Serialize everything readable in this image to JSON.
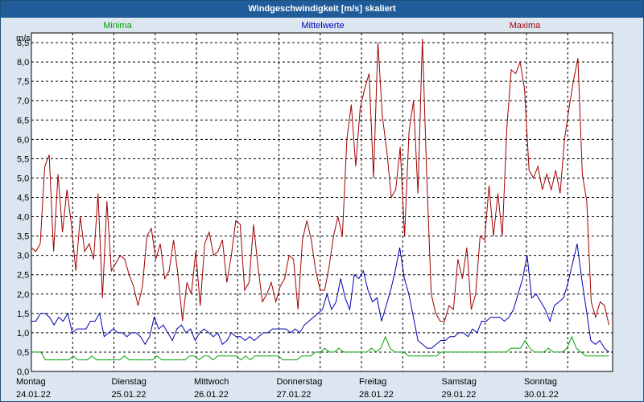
{
  "window": {
    "title": "Windgeschwindigkeit [m/s] skaliert"
  },
  "colors": {
    "background": "#dce6f1",
    "titlebar": "#1f5c99",
    "minima": "#00a000",
    "mittelwerte": "#0000b0",
    "maxima": "#a00000"
  },
  "chart_data": {
    "type": "line",
    "title": "Windgeschwindigkeit [m/s] skaliert",
    "ylabel": "m/s",
    "ylim": [
      0,
      8.75
    ],
    "yticks": [
      "0,0",
      "0,5",
      "1,0",
      "1,5",
      "2,0",
      "2,5",
      "3,0",
      "3,5",
      "4,0",
      "4,5",
      "5,0",
      "5,5",
      "6,0",
      "6,5",
      "7,0",
      "7,5",
      "8,0",
      "8,5"
    ],
    "x_categories": [
      {
        "day": "Montag",
        "date": "24.01.22"
      },
      {
        "day": "Dienstag",
        "date": "25.01.22"
      },
      {
        "day": "Mittwoch",
        "date": "26.01.22"
      },
      {
        "day": "Donnerstag",
        "date": "27.01.22"
      },
      {
        "day": "Freitag",
        "date": "28.01.22"
      },
      {
        "day": "Samstag",
        "date": "29.01.22"
      },
      {
        "day": "Sonntag",
        "date": "30.01.22"
      }
    ],
    "grid": true,
    "legend_position": "top",
    "series": [
      {
        "name": "Minima",
        "color": "#00a000",
        "values": [
          0.5,
          0.5,
          0.5,
          0.3,
          0.3,
          0.3,
          0.3,
          0.3,
          0.3,
          0.4,
          0.3,
          0.3,
          0.3,
          0.4,
          0.3,
          0.3,
          0.3,
          0.3,
          0.3,
          0.3,
          0.4,
          0.3,
          0.3,
          0.3,
          0.3,
          0.3,
          0.3,
          0.4,
          0.3,
          0.3,
          0.3,
          0.3,
          0.3,
          0.3,
          0.4,
          0.4,
          0.3,
          0.4,
          0.4,
          0.3,
          0.4,
          0.4,
          0.4,
          0.4,
          0.4,
          0.3,
          0.4,
          0.3,
          0.4,
          0.4,
          0.4,
          0.4,
          0.4,
          0.4,
          0.3,
          0.3,
          0.3,
          0.3,
          0.4,
          0.4,
          0.4,
          0.5,
          0.5,
          0.6,
          0.5,
          0.5,
          0.6,
          0.5,
          0.5,
          0.5,
          0.5,
          0.5,
          0.5,
          0.6,
          0.5,
          0.6,
          0.9,
          0.6,
          0.5,
          0.5,
          0.5,
          0.4,
          0.4,
          0.4,
          0.4,
          0.4,
          0.4,
          0.4,
          0.5,
          0.5,
          0.5,
          0.5,
          0.5,
          0.5,
          0.5,
          0.5,
          0.5,
          0.5,
          0.5,
          0.5,
          0.5,
          0.5,
          0.5,
          0.6,
          0.6,
          0.6,
          0.8,
          0.6,
          0.5,
          0.5,
          0.5,
          0.6,
          0.5,
          0.5,
          0.5,
          0.6,
          0.9,
          0.6,
          0.5,
          0.4,
          0.4,
          0.4,
          0.4,
          0.4,
          0.4
        ]
      },
      {
        "name": "Mittelwerte",
        "color": "#0000b0",
        "values": [
          1.3,
          1.3,
          1.5,
          1.5,
          1.4,
          1.2,
          1.4,
          1.3,
          1.5,
          1.0,
          1.1,
          1.1,
          1.1,
          1.3,
          1.3,
          1.5,
          0.9,
          1.0,
          1.1,
          1.0,
          1.0,
          0.9,
          1.0,
          1.0,
          0.9,
          0.7,
          0.9,
          1.4,
          1.1,
          1.2,
          1.0,
          0.8,
          1.1,
          1.2,
          1.0,
          1.1,
          0.8,
          1.0,
          1.1,
          1.0,
          0.9,
          1.0,
          0.7,
          0.8,
          1.0,
          0.9,
          0.9,
          0.8,
          0.9,
          0.8,
          0.9,
          1.0,
          1.0,
          1.1,
          1.1,
          1.1,
          1.1,
          1.0,
          1.1,
          1.0,
          1.2,
          1.3,
          1.4,
          1.5,
          1.6,
          2.0,
          1.6,
          1.8,
          2.4,
          1.9,
          1.6,
          2.5,
          2.4,
          2.6,
          2.1,
          1.8,
          1.9,
          1.3,
          1.7,
          2.1,
          2.6,
          3.2,
          2.4,
          2.0,
          1.4,
          0.8,
          0.7,
          0.6,
          0.6,
          0.7,
          0.8,
          0.8,
          0.9,
          0.9,
          1.0,
          1.0,
          0.9,
          1.1,
          1.0,
          1.3,
          1.3,
          1.4,
          1.4,
          1.4,
          1.3,
          1.4,
          1.6,
          2.0,
          2.4,
          3.0,
          1.9,
          2.0,
          1.8,
          1.6,
          1.3,
          1.7,
          1.8,
          1.9,
          2.3,
          2.8,
          3.3,
          2.4,
          1.6,
          0.8,
          0.7,
          0.8,
          0.6,
          0.5
        ]
      },
      {
        "name": "Maxima",
        "color": "#a00000",
        "values": [
          3.2,
          3.1,
          3.3,
          5.3,
          5.6,
          3.1,
          5.1,
          3.6,
          4.7,
          3.8,
          2.6,
          4.0,
          3.1,
          3.3,
          2.9,
          4.6,
          1.9,
          4.4,
          2.6,
          2.8,
          3.0,
          2.9,
          2.5,
          2.2,
          1.7,
          2.2,
          3.5,
          3.7,
          2.9,
          3.3,
          2.4,
          2.6,
          3.4,
          2.5,
          1.3,
          2.3,
          2.0,
          3.1,
          1.7,
          3.3,
          3.6,
          3.0,
          3.1,
          3.4,
          2.3,
          3.0,
          3.9,
          3.8,
          2.1,
          2.3,
          3.8,
          2.7,
          1.8,
          2.0,
          2.3,
          1.8,
          2.2,
          2.4,
          3.0,
          2.9,
          1.6,
          3.4,
          3.9,
          3.4,
          2.6,
          2.1,
          2.1,
          2.7,
          3.5,
          4.0,
          3.5,
          6.0,
          6.9,
          5.3,
          6.8,
          7.3,
          7.7,
          5.0,
          8.5,
          6.6,
          5.7,
          4.5,
          4.7,
          5.8,
          3.5,
          6.2,
          7.0,
          4.6,
          8.6,
          5.0,
          2.0,
          1.5,
          1.3,
          1.3,
          1.7,
          1.6,
          2.9,
          2.4,
          3.2,
          1.6,
          2.0,
          3.5,
          3.4,
          4.8,
          3.5,
          4.6,
          3.5,
          6.3,
          7.8,
          7.7,
          8.0,
          7.3,
          5.2,
          5.0,
          5.3,
          4.7,
          5.1,
          4.7,
          5.2,
          4.6,
          6.0,
          6.8,
          7.5,
          8.1,
          5.1,
          4.4,
          1.8,
          1.4,
          1.8,
          1.7,
          1.2
        ]
      }
    ]
  }
}
